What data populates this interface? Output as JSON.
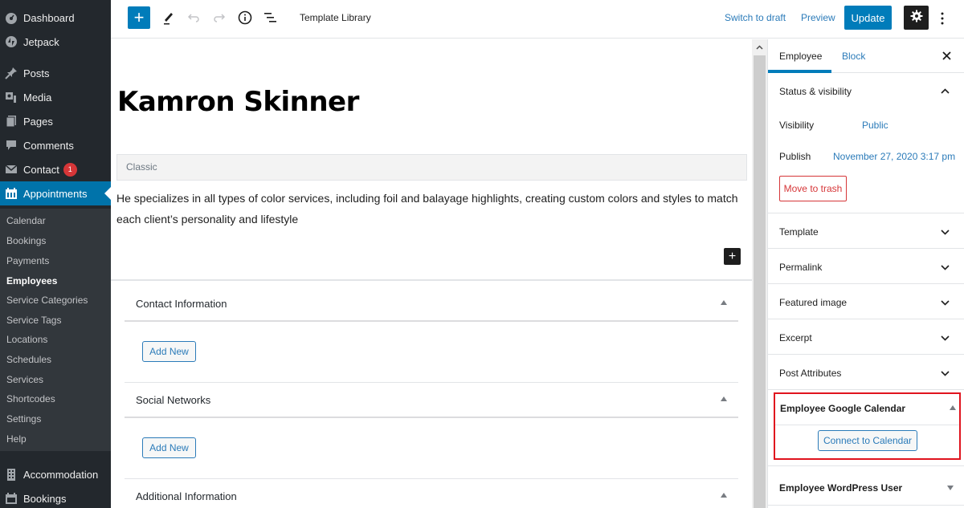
{
  "admin_menu": {
    "items": [
      {
        "label": "Dashboard",
        "icon": "dashboard-icon"
      },
      {
        "label": "Jetpack",
        "icon": "jetpack-icon"
      },
      {
        "label": "Posts",
        "icon": "pin-icon"
      },
      {
        "label": "Media",
        "icon": "media-icon"
      },
      {
        "label": "Pages",
        "icon": "pages-icon"
      },
      {
        "label": "Comments",
        "icon": "comment-icon"
      },
      {
        "label": "Contact",
        "icon": "envelope-icon",
        "badge": "1"
      },
      {
        "label": "Appointments",
        "icon": "calendar-icon",
        "active": true
      }
    ],
    "submenu": [
      "Calendar",
      "Bookings",
      "Payments",
      "Employees",
      "Service Categories",
      "Service Tags",
      "Locations",
      "Schedules",
      "Services",
      "Shortcodes",
      "Settings",
      "Help"
    ],
    "submenu_current": "Employees",
    "bottom_items": [
      {
        "label": "Accommodation",
        "icon": "building-icon"
      },
      {
        "label": "Bookings",
        "icon": "calendar-icon"
      }
    ]
  },
  "toolbar": {
    "add_block": "+",
    "template_library": "Template Library",
    "switch_to_draft": "Switch to draft",
    "preview": "Preview",
    "update": "Update"
  },
  "editor": {
    "title": "Kamron Skinner",
    "classic_label": "Classic",
    "content": "He specializes in all types of color services, including foil and balayage highlights, creating custom colors and styles to match each client’s personality and lifestyle",
    "metaboxes": [
      {
        "title": "Contact Information",
        "button": "Add New"
      },
      {
        "title": "Social Networks",
        "button": "Add New"
      },
      {
        "title": "Additional Information"
      }
    ]
  },
  "sidebar": {
    "tabs": {
      "document": "Employee",
      "block": "Block"
    },
    "status_panel": {
      "title": "Status & visibility",
      "visibility_label": "Visibility",
      "visibility_value": "Public",
      "publish_label": "Publish",
      "publish_value": "November 27, 2020 3:17 pm",
      "trash": "Move to trash"
    },
    "panels": [
      "Template",
      "Permalink",
      "Featured image",
      "Excerpt",
      "Post Attributes"
    ],
    "google_calendar": {
      "title": "Employee Google Calendar",
      "button": "Connect to Calendar",
      "highlight_color": "#e0141e"
    },
    "wp_user": {
      "title": "Employee WordPress User"
    }
  },
  "colors": {
    "accent": "#007cba",
    "admin_bg": "#23282d",
    "link": "#2b7bb9",
    "danger": "#d63638"
  }
}
